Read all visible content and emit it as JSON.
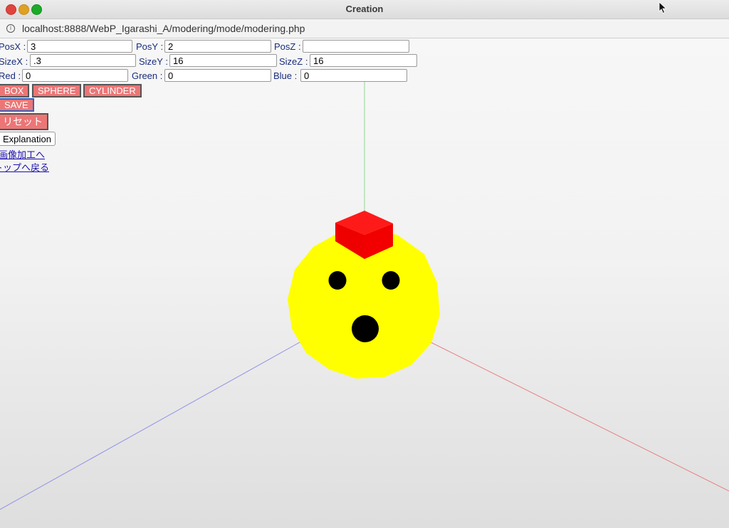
{
  "window": {
    "title": "Creation"
  },
  "address_bar": {
    "url": "localhost:8888/WebP_Igarashi_A/modering/mode/modering.php"
  },
  "form": {
    "posx": {
      "label": "PosX :",
      "value": "3"
    },
    "posy": {
      "label": "PosY :",
      "value": "2"
    },
    "posz": {
      "label": "PosZ :",
      "value": ""
    },
    "sizex": {
      "label": "SizeX :",
      "value": ".3"
    },
    "sizey": {
      "label": "SizeY :",
      "value": "16"
    },
    "sizez": {
      "label": "SizeZ :",
      "value": "16"
    },
    "red": {
      "label": "Red :",
      "value": "0"
    },
    "green": {
      "label": "Green :",
      "value": "0"
    },
    "blue": {
      "label": "Blue :",
      "value": "0"
    }
  },
  "buttons": {
    "box": "BOX",
    "sphere": "SPHERE",
    "cylinder": "CYLINDER",
    "save": "SAVE",
    "reset": "リセット",
    "explanation": "Explanation"
  },
  "links": {
    "image_edit": "画像加工へ",
    "back_top": "トップへ戻る"
  },
  "scene": {
    "colors": {
      "sphere": "#ffff00",
      "box": "#ff0000",
      "eyes": "#000000",
      "axis_x": "#e88080",
      "axis_y": "#90d890",
      "axis_z": "#9090e8"
    }
  }
}
